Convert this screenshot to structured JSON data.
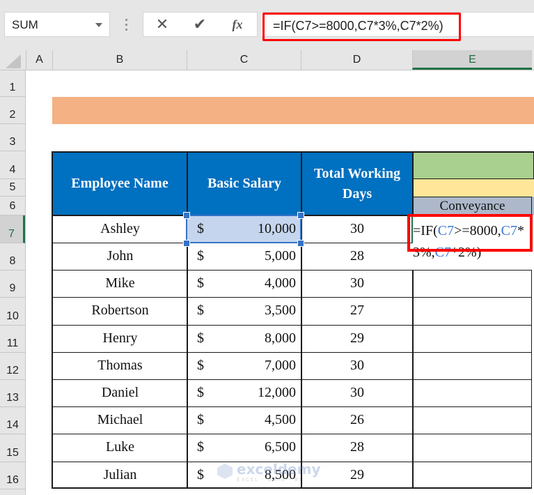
{
  "toolbar": {
    "name_box": "SUM",
    "cancel_icon": "✕",
    "enter_icon": "✔",
    "fx_label": "fx",
    "formula": "=IF(C7>=8000,C7*3%,C7*2%)"
  },
  "columns": [
    "A",
    "B",
    "C",
    "D",
    "E"
  ],
  "selected_column": "E",
  "rows": [
    "1",
    "2",
    "3",
    "4",
    "5",
    "6",
    "7",
    "8",
    "9",
    "10",
    "11",
    "12",
    "13",
    "14",
    "15",
    "16"
  ],
  "selected_row": "7",
  "table": {
    "headers": {
      "employee_name": "Employee Name",
      "basic_salary": "Basic Salary",
      "total_working_days": "Total Working Days",
      "conveyance": "Conveyance"
    },
    "currency_symbol": "$",
    "records": [
      {
        "name": "Ashley",
        "salary": "10,000",
        "days": "30"
      },
      {
        "name": "John",
        "salary": "5,000",
        "days": "28"
      },
      {
        "name": "Mike",
        "salary": "4,000",
        "days": "30"
      },
      {
        "name": "Robertson",
        "salary": "3,500",
        "days": "27"
      },
      {
        "name": "Henry",
        "salary": "8,000",
        "days": "29"
      },
      {
        "name": "Thomas",
        "salary": "7,000",
        "days": "30"
      },
      {
        "name": "Daniel",
        "salary": "12,000",
        "days": "30"
      },
      {
        "name": "Michael",
        "salary": "4,500",
        "days": "26"
      },
      {
        "name": "Luke",
        "salary": "6,500",
        "days": "28"
      },
      {
        "name": "Julian",
        "salary": "8,500",
        "days": "29"
      }
    ]
  },
  "edit_cell": {
    "line1_parts": [
      {
        "text": "=IF(",
        "ref": false
      },
      {
        "text": "C7",
        "ref": true
      },
      {
        "text": ">=8000,",
        "ref": false
      },
      {
        "text": "C7",
        "ref": true
      },
      {
        "text": "*",
        "ref": false
      }
    ],
    "line2_parts": [
      {
        "text": "3%,",
        "ref": false
      },
      {
        "text": "C7",
        "ref": true
      },
      {
        "text": "*2%)",
        "ref": false
      }
    ]
  },
  "watermark": {
    "brand": "exceldemy",
    "tagline": "EXCEL · DATA · BI"
  },
  "colors": {
    "header_blue": "#0070c0",
    "banner_orange": "#f4b183",
    "green_band": "#a9d08e",
    "yellow_band": "#ffe699",
    "conveyance_gray": "#adb9ca",
    "highlight_red": "#ff0000",
    "selection_blue": "#3572c6",
    "excel_green": "#217346"
  }
}
